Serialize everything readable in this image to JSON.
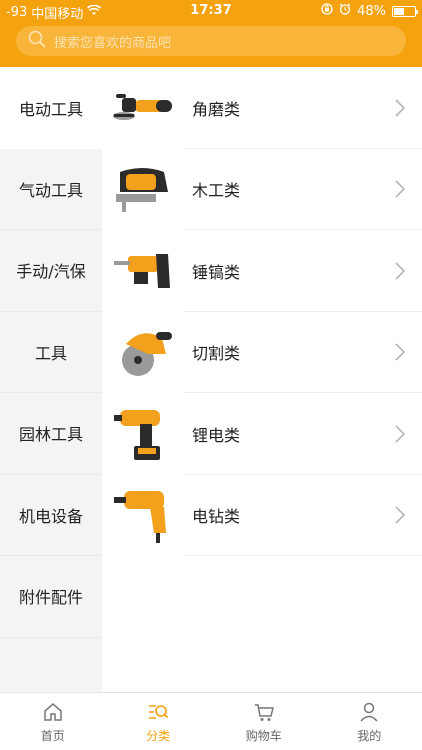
{
  "status": {
    "signal": "-93",
    "carrier": "中国移动",
    "time": "17:37",
    "battery_text": "48%",
    "battery_level": 0.48
  },
  "search": {
    "placeholder": "搜索您喜欢的商品吧"
  },
  "sidebar": {
    "items": [
      {
        "label": "电动工具",
        "active": true
      },
      {
        "label": "气动工具",
        "active": false
      },
      {
        "label": "手动/汽保",
        "active": false
      },
      {
        "label": "工具",
        "active": false
      },
      {
        "label": "园林工具",
        "active": false
      },
      {
        "label": "机电设备",
        "active": false
      },
      {
        "label": "附件配件",
        "active": false
      }
    ]
  },
  "categories": [
    {
      "label": "角磨类",
      "icon": "angle-grinder-icon"
    },
    {
      "label": "木工类",
      "icon": "jigsaw-icon"
    },
    {
      "label": "锤镐类",
      "icon": "rotary-hammer-icon"
    },
    {
      "label": "切割类",
      "icon": "circular-saw-icon"
    },
    {
      "label": "锂电类",
      "icon": "cordless-drill-icon"
    },
    {
      "label": "电钻类",
      "icon": "electric-drill-icon"
    }
  ],
  "tabbar": {
    "items": [
      {
        "label": "首页",
        "icon": "home-icon"
      },
      {
        "label": "分类",
        "icon": "category-search-icon"
      },
      {
        "label": "购物车",
        "icon": "cart-icon"
      },
      {
        "label": "我的",
        "icon": "user-icon"
      }
    ],
    "active_index": 1
  },
  "colors": {
    "accent": "#f5a20f",
    "search_bg": "#f8b53a",
    "sidebar_bg": "#f4f4f4"
  }
}
